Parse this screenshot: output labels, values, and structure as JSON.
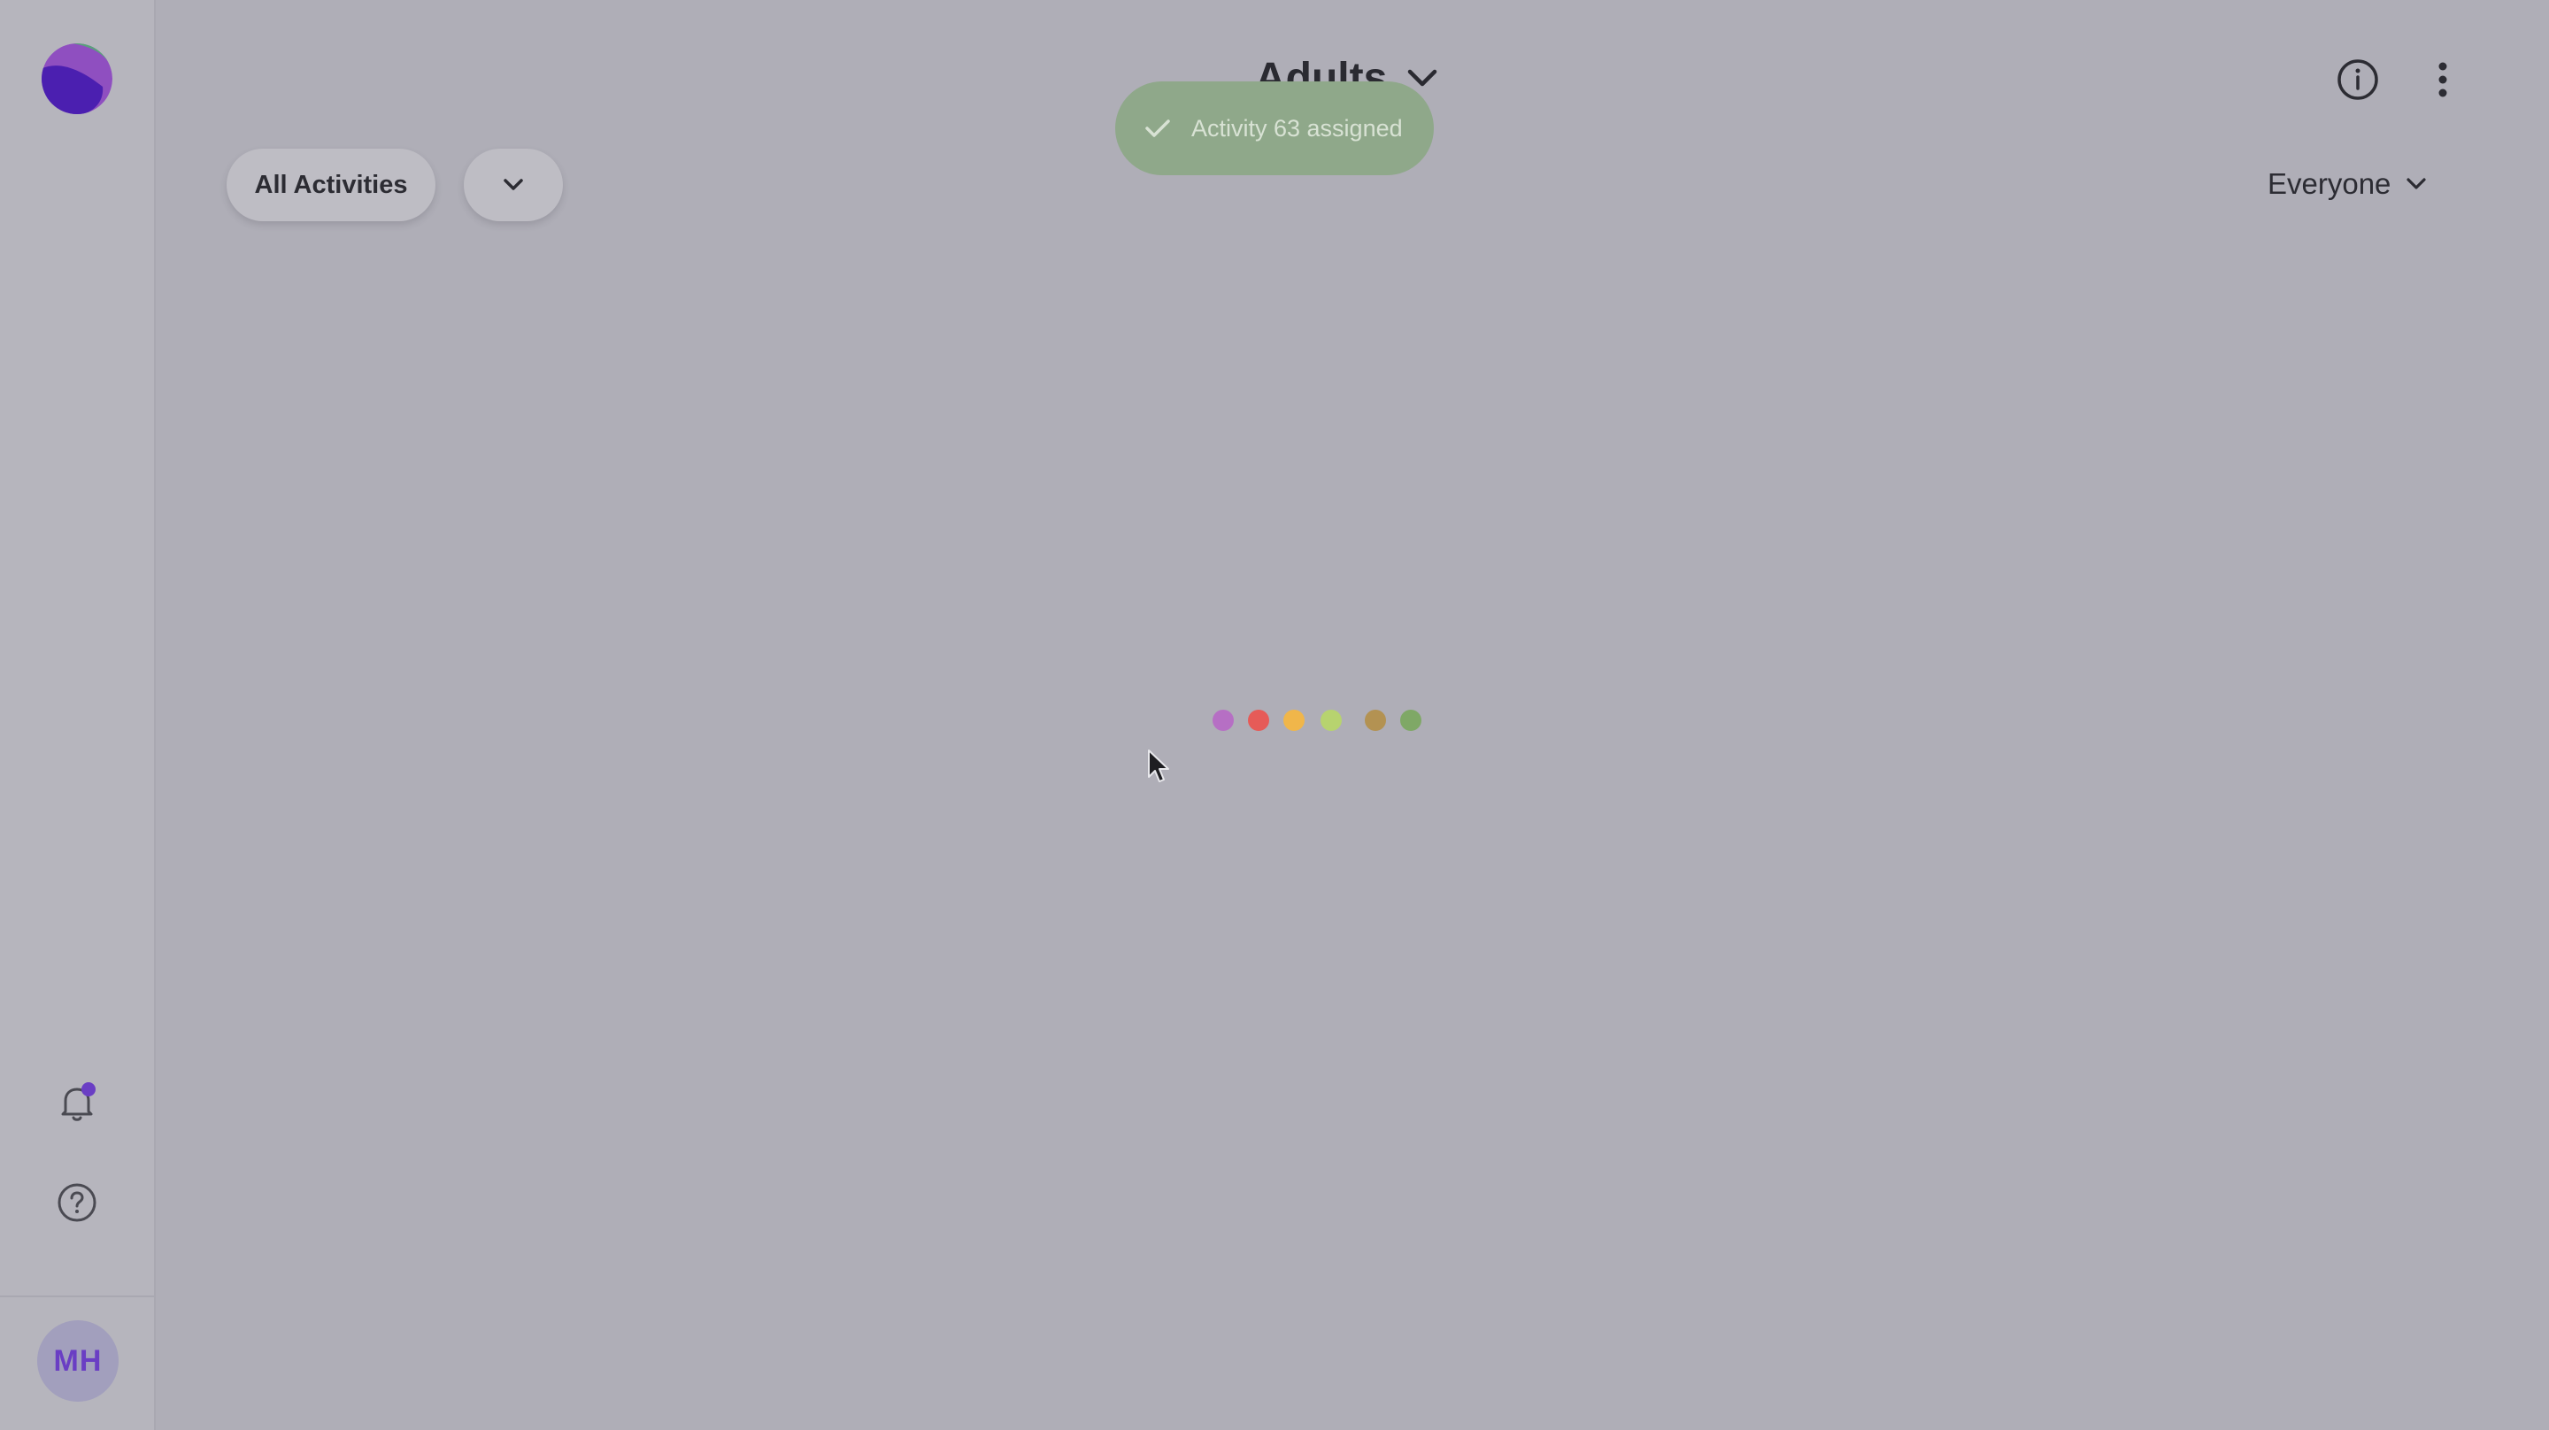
{
  "header": {
    "title": "Adults"
  },
  "toast": {
    "message": "Activity 63 assigned"
  },
  "filters": {
    "activities_label": "All Activities",
    "audience_label": "Everyone"
  },
  "user": {
    "initials": "MH"
  },
  "loader": {
    "dot_colors": [
      "#b66fc4",
      "#e65b58",
      "#f0b64a",
      "#b7d36f",
      "#b39252",
      "#7fa866"
    ]
  },
  "icons": {
    "logo": "app-logo",
    "bell": "bell-icon",
    "help": "help-circle-icon",
    "info": "info-icon",
    "more": "more-vertical-icon",
    "chevron": "chevron-down-icon",
    "check": "check-icon"
  },
  "colors": {
    "accent": "#6a3ec4",
    "toast": "#8fa88a",
    "background": "#afaeb7"
  }
}
